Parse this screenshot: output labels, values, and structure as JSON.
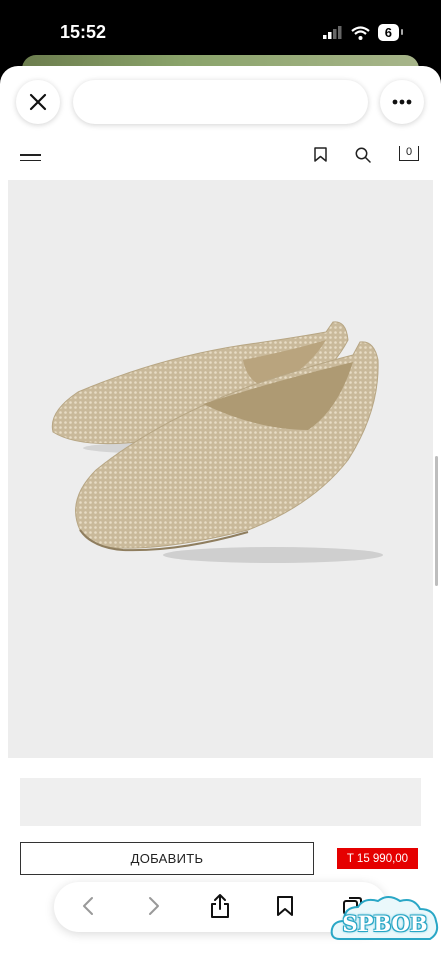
{
  "status_bar": {
    "time": "15:52",
    "battery_level": "6"
  },
  "browser": {
    "close_icon": "close-icon",
    "more_icon": "more-icon",
    "url_text": ""
  },
  "site_header": {
    "menu_icon": "hamburger-icon",
    "bookmark_icon": "bookmark-icon",
    "search_icon": "search-icon",
    "cart_count": "0"
  },
  "product": {
    "image_subject": "knit ballet flat shoes",
    "add_button_label": "ДОБАВИТЬ",
    "price": "T 15 990,00",
    "price_color": "#e50000"
  },
  "bottom_toolbar": {
    "icons": [
      "back-icon",
      "forward-icon",
      "share-icon",
      "bookmarks-icon",
      "tabs-icon"
    ]
  },
  "watermark": {
    "text": "SPBOB"
  }
}
